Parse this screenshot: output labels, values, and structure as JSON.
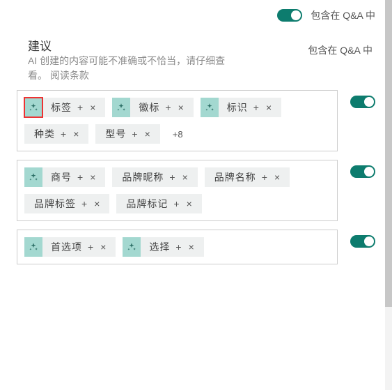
{
  "top": {
    "toggle": true,
    "label": "包含在 Q&A 中"
  },
  "suggest": {
    "title": "建议",
    "sub_pre": "AI 创建的内容可能不准确或不恰当，请仔细查看。",
    "link": "阅读条款",
    "right": "包含在 Q&A 中"
  },
  "groups": [
    {
      "toggle": true,
      "chips": [
        {
          "sparkle": true,
          "highlight": true,
          "name": "标签",
          "plus": true,
          "x": true
        },
        {
          "sparkle": true,
          "name": "徽标",
          "plus": true,
          "x": true
        },
        {
          "sparkle": true,
          "name": "标识",
          "plus": true,
          "x": true
        },
        {
          "plain": true,
          "name": "种类",
          "plus": true,
          "x": true
        },
        {
          "plain": true,
          "name": "型号",
          "plus": true,
          "x": true
        }
      ],
      "more": "+8"
    },
    {
      "toggle": true,
      "chips": [
        {
          "sparkle": true,
          "name": "商号",
          "plus": true,
          "x": true
        },
        {
          "plain": true,
          "name": "品牌昵称",
          "plus": true,
          "x": true
        },
        {
          "plain": true,
          "name": "品牌名称",
          "plus": true,
          "x": true
        },
        {
          "plain": true,
          "name": "品牌标签",
          "plus": true,
          "x": true
        },
        {
          "plain": true,
          "name": "品牌标记",
          "plus": true,
          "x": true
        }
      ]
    },
    {
      "toggle": true,
      "chips": [
        {
          "sparkle": true,
          "name": "首选项",
          "plus": true,
          "x": true
        },
        {
          "sparkle": true,
          "name": "选择",
          "plus": true,
          "x": true
        }
      ]
    }
  ]
}
